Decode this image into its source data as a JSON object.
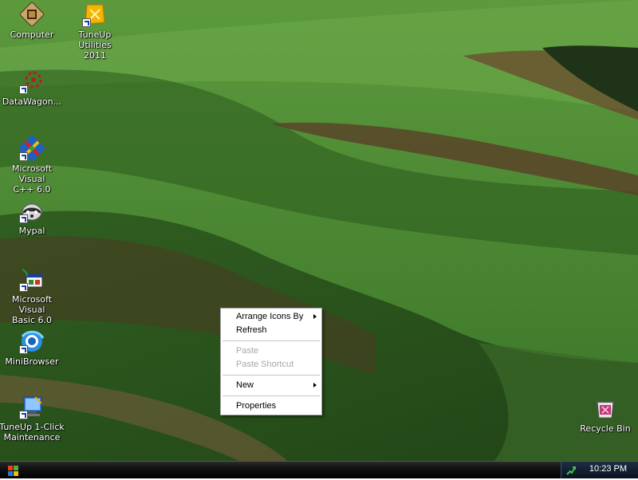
{
  "desktop_icons": [
    {
      "label": "Computer",
      "icon": "computer-icon",
      "shortcut": false
    },
    {
      "label": "TuneUp Utilities\n2011",
      "icon": "tuneup-utilities-icon",
      "shortcut": true
    },
    {
      "label": "DataWagon...",
      "icon": "datawagon-icon",
      "shortcut": true
    },
    {
      "label": "Microsoft Visual\nC++ 6.0",
      "icon": "visual-cpp-icon",
      "shortcut": true
    },
    {
      "label": "Mypal",
      "icon": "mypal-icon",
      "shortcut": true
    },
    {
      "label": "Microsoft Visual\nBasic 6.0",
      "icon": "visual-basic-icon",
      "shortcut": true
    },
    {
      "label": "MiniBrowser",
      "icon": "minibrowser-icon",
      "shortcut": true
    },
    {
      "label": "TuneUp 1-Click\nMaintenance",
      "icon": "tuneup-maintenance-icon",
      "shortcut": true
    },
    {
      "label": "Recycle Bin",
      "icon": "recycle-bin-icon",
      "shortcut": false
    }
  ],
  "context_menu": {
    "arrange_icons_by": "Arrange Icons By",
    "refresh": "Refresh",
    "paste": "Paste",
    "paste_shortcut": "Paste Shortcut",
    "new": "New",
    "properties": "Properties"
  },
  "taskbar": {
    "clock": "10:23 PM"
  },
  "colors": {
    "taskbar": "#0d0d0d",
    "menu_background": "#ffffff",
    "menu_disabled_text": "#a8a8a8"
  }
}
